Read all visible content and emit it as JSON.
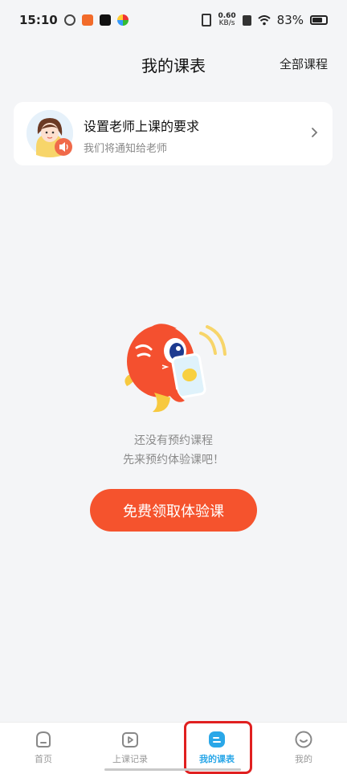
{
  "status_bar": {
    "time": "15:10",
    "net_speed_value": "0.60",
    "net_speed_unit": "KB/s",
    "battery": "83%"
  },
  "header": {
    "title": "我的课表",
    "all_courses": "全部课程"
  },
  "requirement_card": {
    "title": "设置老师上课的要求",
    "subtitle": "我们将通知给老师"
  },
  "empty_state": {
    "line1": "还没有预约课程",
    "line2": "先来预约体验课吧！",
    "button": "免费领取体验课"
  },
  "bottom_nav": {
    "items": [
      {
        "label": "首页",
        "icon": "home-icon"
      },
      {
        "label": "上课记录",
        "icon": "play-icon"
      },
      {
        "label": "我的课表",
        "icon": "schedule-icon",
        "active": true
      },
      {
        "label": "我的",
        "icon": "smiley-icon"
      }
    ]
  },
  "colors": {
    "accent": "#f5532d",
    "active_tab": "#2aa7e8",
    "highlight": "#e02020"
  }
}
